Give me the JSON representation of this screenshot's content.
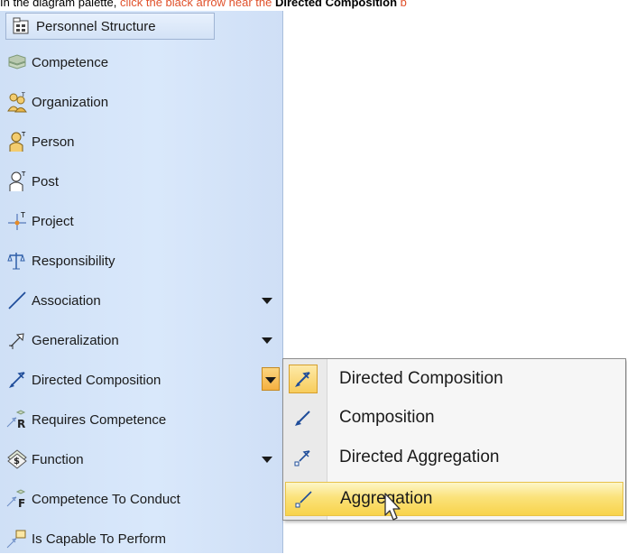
{
  "instruction": {
    "part1": "In the diagram palette,",
    "part2": "click the black arrow near the",
    "part3": "Directed Composition",
    "part4": "b"
  },
  "palette": {
    "header": {
      "label": "Personnel Structure",
      "icon": "package-icon"
    },
    "items": [
      {
        "label": "Competence",
        "icon": "competence-icon"
      },
      {
        "label": "Organization",
        "icon": "organization-icon"
      },
      {
        "label": "Person",
        "icon": "person-icon"
      },
      {
        "label": "Post",
        "icon": "post-icon"
      },
      {
        "label": "Project",
        "icon": "project-icon"
      },
      {
        "label": "Responsibility",
        "icon": "responsibility-icon"
      },
      {
        "label": "Association",
        "icon": "association-icon",
        "has_dropdown": true
      },
      {
        "label": "Generalization",
        "icon": "generalization-icon",
        "has_dropdown": true
      },
      {
        "label": "Directed Composition",
        "icon": "directed-composition-icon",
        "has_dropdown": true,
        "dropdown_active": true
      },
      {
        "label": "Requires Competence",
        "icon": "requires-competence-icon"
      },
      {
        "label": "Function",
        "icon": "function-icon",
        "has_dropdown": true
      },
      {
        "label": "Competence To Conduct",
        "icon": "competence-to-conduct-icon"
      },
      {
        "label": "Is Capable To Perform",
        "icon": "is-capable-to-perform-icon"
      }
    ]
  },
  "popup_menu": {
    "items": [
      {
        "label": "Directed Composition",
        "icon": "directed-composition-icon",
        "checked": true
      },
      {
        "label": "Composition",
        "icon": "composition-icon"
      },
      {
        "label": "Directed Aggregation",
        "icon": "directed-aggregation-icon"
      },
      {
        "label": "Aggregation",
        "icon": "aggregation-icon",
        "hovered": true
      }
    ]
  },
  "colors": {
    "palette_bg": "#d9e8fb",
    "highlight": "#f8d34b",
    "link_text": "#e0522c"
  }
}
